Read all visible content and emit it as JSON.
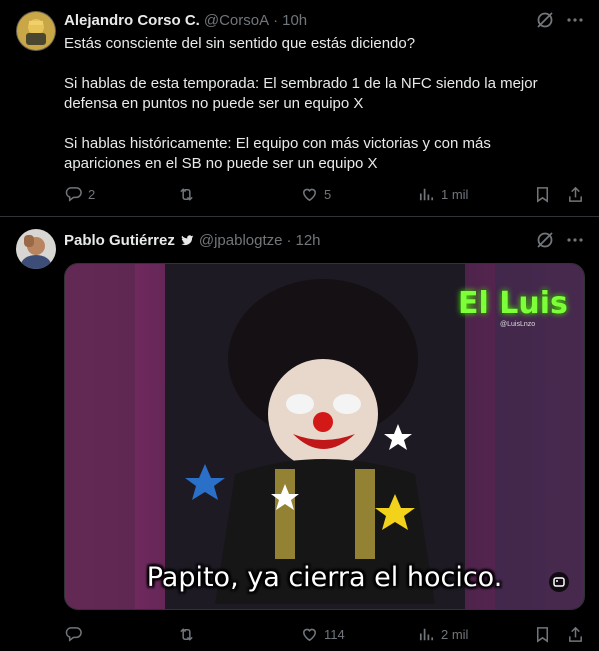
{
  "tweets": [
    {
      "author": "Alejandro Corso C.",
      "handle": "@CorsoA",
      "dot": "·",
      "time": "10h",
      "text": [
        "Estás consciente del sin sentido que estás diciendo?",
        "",
        "Si hablas de esta temporada: El sembrado 1 de la NFC siendo la mejor defensa en puntos no puede ser un equipo X",
        "",
        "Si hablas históricamente: El equipo con más victorias y con más apariciones en el SB no puede ser un equipo X"
      ],
      "replies": "2",
      "retweets": "",
      "likes": "5",
      "views": "1 mil"
    },
    {
      "author": "Pablo Gutiérrez",
      "handle": "@jpablogtze",
      "dot": "·",
      "time": "12h",
      "media": {
        "caption": "Papito, ya cierra el hocico.",
        "logo": "El Luis",
        "logo_sub": "@LuisLnzo"
      },
      "replies": "",
      "retweets": "",
      "likes": "114",
      "views": "2 mil"
    }
  ],
  "colors": {
    "background": "#000000",
    "text": "#e7e9ea",
    "muted": "#71767b",
    "divider": "#2f3336"
  }
}
